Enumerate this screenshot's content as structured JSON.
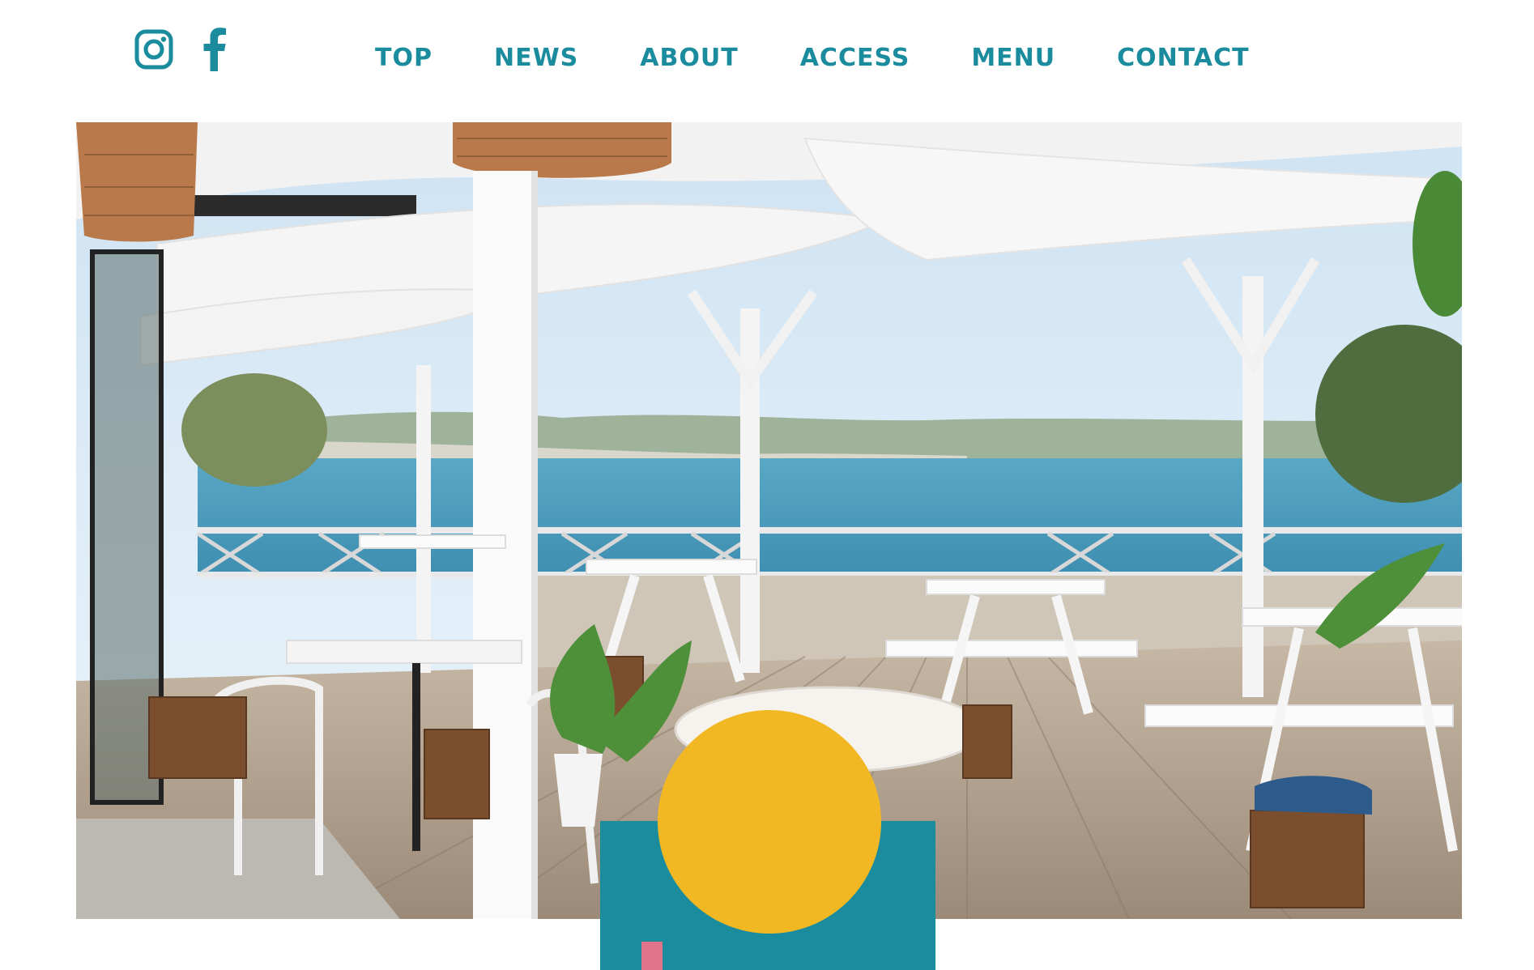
{
  "social": {
    "instagram_icon": "instagram-icon",
    "facebook_icon": "facebook-icon"
  },
  "nav": {
    "items": [
      {
        "label": "TOP"
      },
      {
        "label": "NEWS"
      },
      {
        "label": "ABOUT"
      },
      {
        "label": "ACCESS"
      },
      {
        "label": "MENU"
      },
      {
        "label": "CONTACT"
      }
    ]
  },
  "colors": {
    "accent_teal": "#1b8c9e",
    "sun_yellow": "#f2b824",
    "pink": "#e0728a",
    "background": "#ffffff"
  },
  "hero": {
    "subject": "cafe-terrace-ocean-view-photo"
  },
  "logo": {
    "icon": "sun-logo-icon"
  }
}
